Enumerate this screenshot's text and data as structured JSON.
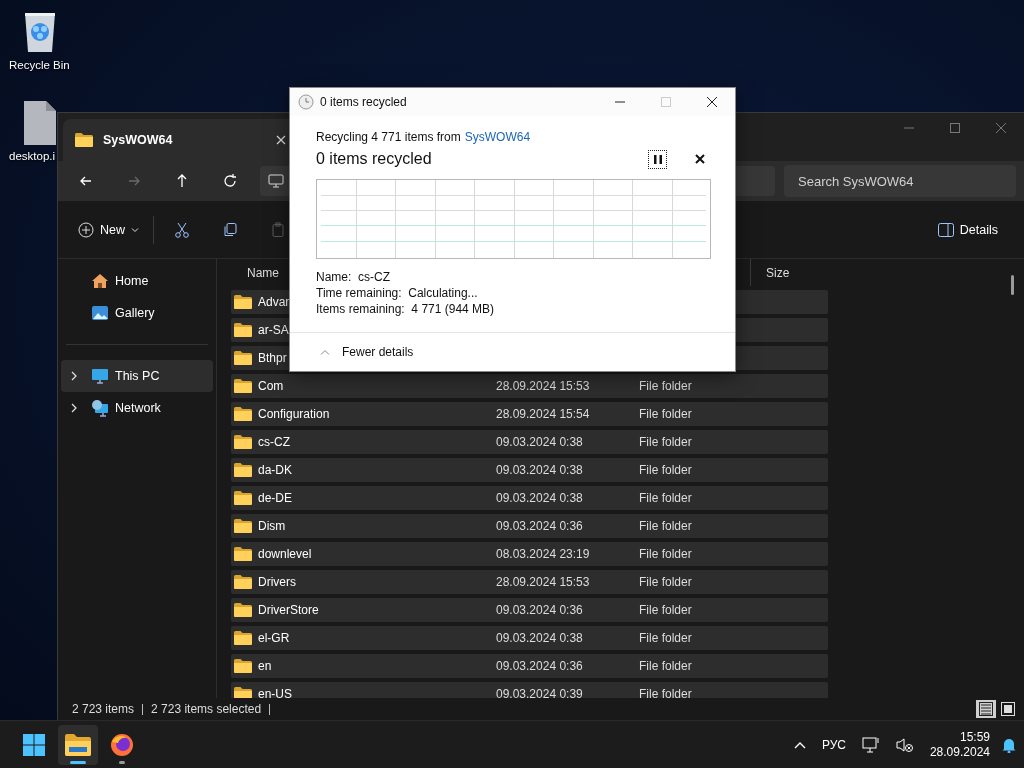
{
  "desktop_icons": [
    {
      "label": "Recycle Bin",
      "kind": "recycle-bin"
    },
    {
      "label": "desktop.i",
      "kind": "file"
    }
  ],
  "explorer": {
    "tab": {
      "title": "SysWOW64"
    },
    "nav_buttons": [
      {
        "kind": "back",
        "disabled": false
      },
      {
        "kind": "forward",
        "disabled": true
      },
      {
        "kind": "up",
        "disabled": false
      },
      {
        "kind": "refresh",
        "disabled": false
      }
    ],
    "search": {
      "placeholder": "Search SysWOW64"
    },
    "commands": [
      {
        "kind": "new",
        "label": "New",
        "disabled": false
      },
      {
        "kind": "cut",
        "disabled": false
      },
      {
        "kind": "copy",
        "disabled": false
      },
      {
        "kind": "paste",
        "disabled": true
      }
    ],
    "details_button": {
      "label": "Details"
    },
    "sidebar": {
      "groups": [
        [
          {
            "label": "Home",
            "kind": "home",
            "selected": false,
            "expandable": false
          },
          {
            "label": "Gallery",
            "kind": "gallery",
            "selected": false,
            "expandable": false
          }
        ],
        [
          {
            "label": "This PC",
            "kind": "pc",
            "selected": true,
            "expandable": true
          },
          {
            "label": "Network",
            "kind": "network",
            "selected": false,
            "expandable": true
          }
        ]
      ]
    },
    "columns": [
      {
        "label": "Name",
        "kind": "name"
      },
      {
        "label": "Size",
        "kind": "size"
      }
    ],
    "rows": [
      {
        "name": "Advan",
        "selected": true
      },
      {
        "name": "ar-SA",
        "selected": true
      },
      {
        "name": "Bthpr",
        "selected": true
      },
      {
        "name": "Com",
        "date": "28.09.2024 15:53",
        "type": "File folder",
        "selected": true
      },
      {
        "name": "Configuration",
        "date": "28.09.2024 15:54",
        "type": "File folder",
        "selected": true
      },
      {
        "name": "cs-CZ",
        "date": "09.03.2024 0:38",
        "type": "File folder",
        "selected": true
      },
      {
        "name": "da-DK",
        "date": "09.03.2024 0:38",
        "type": "File folder",
        "selected": true
      },
      {
        "name": "de-DE",
        "date": "09.03.2024 0:38",
        "type": "File folder",
        "selected": true
      },
      {
        "name": "Dism",
        "date": "09.03.2024 0:36",
        "type": "File folder",
        "selected": true
      },
      {
        "name": "downlevel",
        "date": "08.03.2024 23:19",
        "type": "File folder",
        "selected": true
      },
      {
        "name": "Drivers",
        "date": "28.09.2024 15:53",
        "type": "File folder",
        "selected": true
      },
      {
        "name": "DriverStore",
        "date": "09.03.2024 0:36",
        "type": "File folder",
        "selected": true
      },
      {
        "name": "el-GR",
        "date": "09.03.2024 0:38",
        "type": "File folder",
        "selected": true
      },
      {
        "name": "en",
        "date": "09.03.2024 0:36",
        "type": "File folder",
        "selected": true
      },
      {
        "name": "en-US",
        "date": "09.03.2024 0:39",
        "type": "File folder",
        "selected": true
      }
    ],
    "status_bar": {
      "item_count": "2 723 items",
      "selection": "2 723 items selected"
    },
    "views": [
      {
        "kind": "details",
        "selected": true
      },
      {
        "kind": "tiles",
        "selected": false
      }
    ]
  },
  "dialog": {
    "title": "0 items recycled",
    "window_buttons": [
      {
        "kind": "minimize",
        "disabled": false
      },
      {
        "kind": "maximize",
        "disabled": true
      },
      {
        "kind": "close",
        "disabled": false
      }
    ],
    "summary": "Recycling 4 771 items from",
    "source_link": "SysWOW64",
    "heading": "0 items recycled",
    "details": [
      "Name:  cs-CZ",
      "Time remaining:  Calculating...",
      "Items remaining:  4 771 (944 MB)"
    ],
    "toggle": "Fewer details"
  },
  "taskbar": {
    "apps": [
      {
        "kind": "start",
        "active": false,
        "running": false
      },
      {
        "kind": "explorer",
        "active": true,
        "running": true
      },
      {
        "kind": "firefox",
        "active": false,
        "running": true
      }
    ],
    "tray": {
      "language": "РУС",
      "time": "15:59",
      "date": "28.09.2024"
    }
  }
}
